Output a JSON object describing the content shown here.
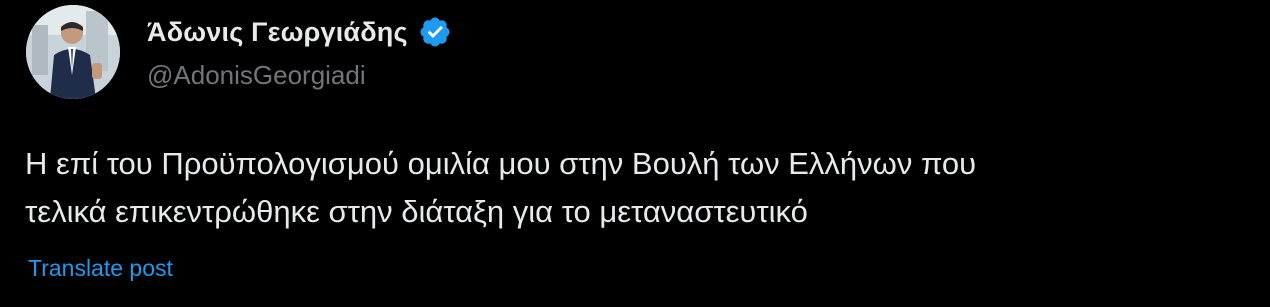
{
  "author": {
    "display_name": "Άδωνις Γεωργιάδης",
    "handle": "@AdonisGeorgiadi",
    "verified": true,
    "avatar_icon": "profile-photo"
  },
  "tweet": {
    "lines": [
      "Η επί του Προϋπολογισμού ομιλία μου στην Βουλή των Ελλήνων που",
      "τελικά επικεντρώθηκε στην διάταξη για το μεταναστευτικό"
    ]
  },
  "actions": {
    "translate_label": "Translate post"
  },
  "colors": {
    "background": "#000000",
    "primary_text": "#e7e9ea",
    "secondary_text": "#71767b",
    "accent": "#1d9bf0"
  }
}
